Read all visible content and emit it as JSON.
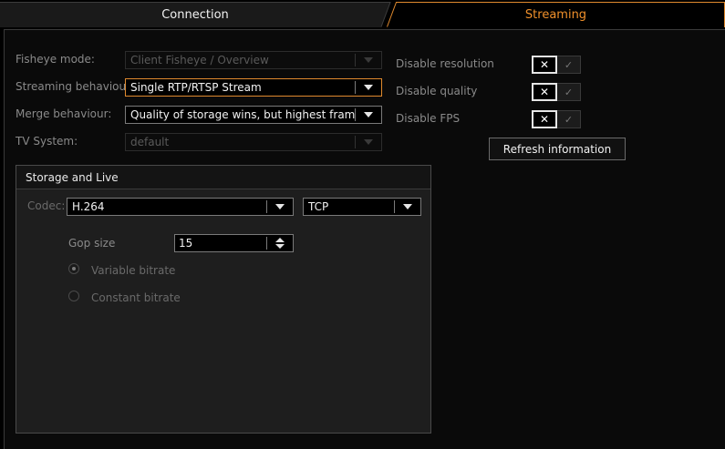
{
  "tabs": [
    {
      "label": "Connection"
    },
    {
      "label": "Streaming"
    }
  ],
  "settings": {
    "fisheye_mode": {
      "label": "Fisheye mode:",
      "value": "Client Fisheye / Overview"
    },
    "streaming_behaviour": {
      "label": "Streaming behaviour:",
      "value": "Single RTP/RTSP Stream"
    },
    "merge_behaviour": {
      "label": "Merge behaviour:",
      "value": "Quality of storage wins, but highest framerate"
    },
    "tv_system": {
      "label": "TV System:",
      "value": "default"
    }
  },
  "toggles": {
    "disable_resolution": {
      "label": "Disable resolution",
      "off": "✕",
      "on": "✓"
    },
    "disable_quality": {
      "label": "Disable quality",
      "off": "✕",
      "on": "✓"
    },
    "disable_fps": {
      "label": "Disable FPS",
      "off": "✕",
      "on": "✓"
    }
  },
  "refresh_button": {
    "label": "Refresh information"
  },
  "storage_live": {
    "title": "Storage and Live",
    "codec": {
      "label": "Codec:",
      "value": "H.264"
    },
    "transport": {
      "value": "TCP"
    },
    "gop_size": {
      "label": "Gop size",
      "value": "15"
    },
    "variable_bitrate": {
      "label": "Variable bitrate"
    },
    "constant_bitrate": {
      "label": "Constant bitrate"
    }
  },
  "colors": {
    "accent": "#f0902b",
    "focus_border": "#e08a2e",
    "panel": "#0a0a0a",
    "group": "#1e1e1e"
  }
}
